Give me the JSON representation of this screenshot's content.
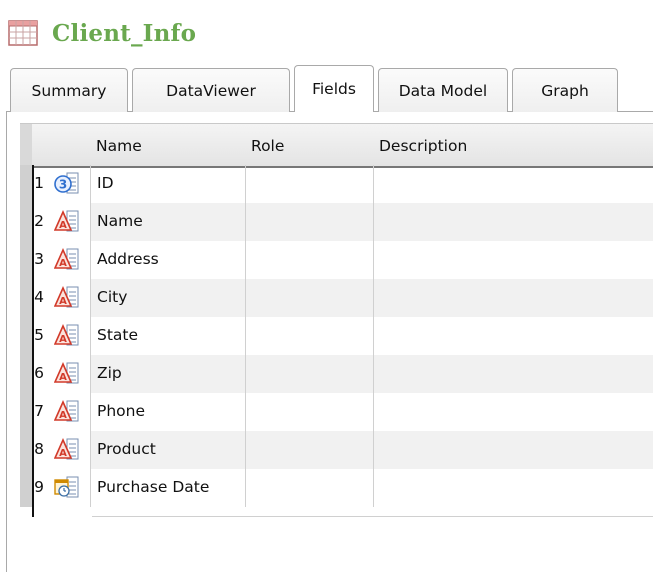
{
  "window": {
    "title": "Client_Info"
  },
  "tabs": [
    {
      "label": "Summary",
      "active": false
    },
    {
      "label": "DataViewer",
      "active": false
    },
    {
      "label": "Fields",
      "active": true
    },
    {
      "label": "Data Model",
      "active": false
    },
    {
      "label": "Graph",
      "active": false
    }
  ],
  "table": {
    "columns": [
      "Name",
      "Role",
      "Description"
    ],
    "rows": [
      {
        "num": "1",
        "type": "number-icon",
        "name": "ID",
        "role": "",
        "description": ""
      },
      {
        "num": "2",
        "type": "string-icon",
        "name": "Name",
        "role": "",
        "description": ""
      },
      {
        "num": "3",
        "type": "string-icon",
        "name": "Address",
        "role": "",
        "description": ""
      },
      {
        "num": "4",
        "type": "string-icon",
        "name": "City",
        "role": "",
        "description": ""
      },
      {
        "num": "5",
        "type": "string-icon",
        "name": "State",
        "role": "",
        "description": ""
      },
      {
        "num": "6",
        "type": "string-icon",
        "name": "Zip",
        "role": "",
        "description": ""
      },
      {
        "num": "7",
        "type": "string-icon",
        "name": "Phone",
        "role": "",
        "description": ""
      },
      {
        "num": "8",
        "type": "string-icon",
        "name": "Product",
        "role": "",
        "description": ""
      },
      {
        "num": "9",
        "type": "date-icon",
        "name": "Purchase Date",
        "role": "",
        "description": ""
      }
    ]
  },
  "colors": {
    "title": "#6aa84f",
    "number_icon": "#2f6fcf",
    "string_icon": "#d23a2a",
    "date_icon": "#d08a00"
  }
}
